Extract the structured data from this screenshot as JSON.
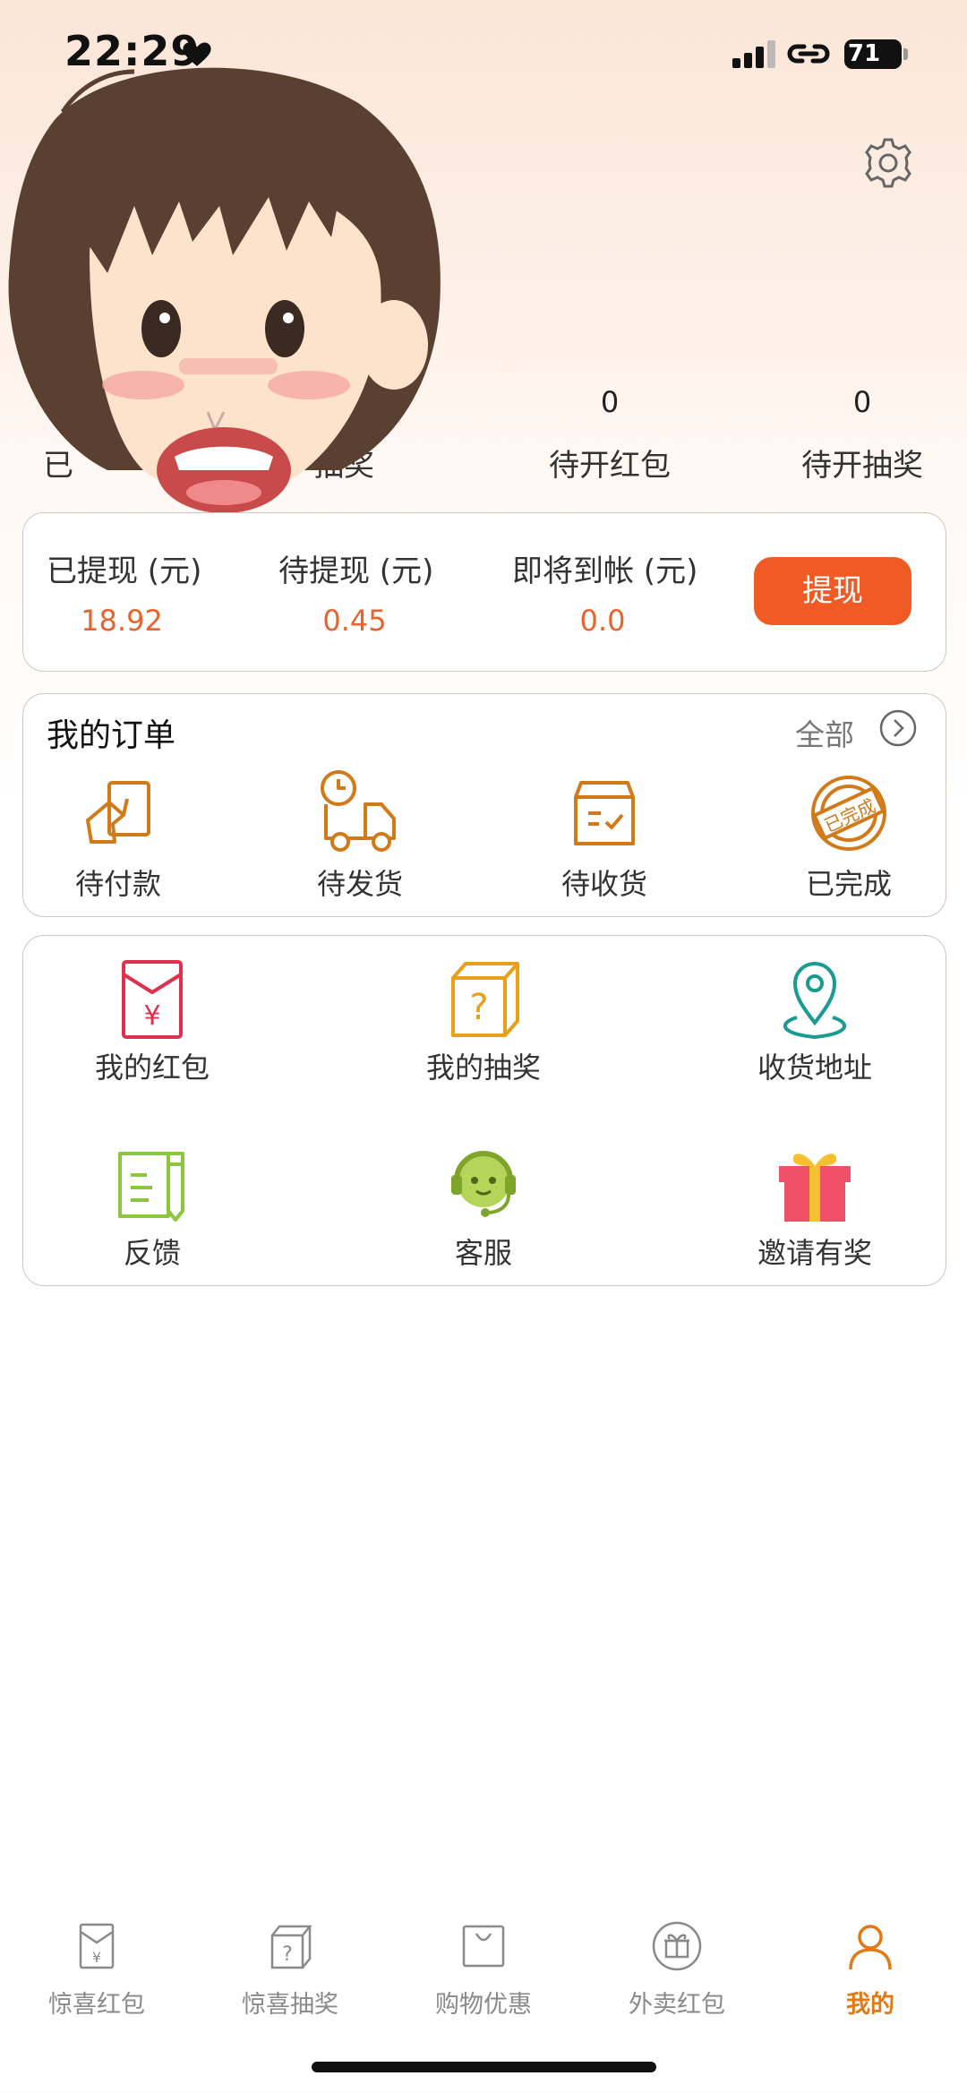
{
  "status_bar": {
    "time": "22:29",
    "battery": "71"
  },
  "stats": [
    {
      "value": "",
      "label": "已"
    },
    {
      "value": "",
      "label": "抽奖"
    },
    {
      "value": "0",
      "label": "待开红包"
    },
    {
      "value": "0",
      "label": "待开抽奖"
    }
  ],
  "withdraw": {
    "items": [
      {
        "label": "已提现 (元)",
        "value": "18.92"
      },
      {
        "label": "待提现 (元)",
        "value": "0.45"
      },
      {
        "label": "即将到帐 (元)",
        "value": "0.0"
      }
    ],
    "button": "提现"
  },
  "orders": {
    "title": "我的订单",
    "all_label": "全部",
    "items": [
      {
        "label": "待付款",
        "icon": "payment-icon"
      },
      {
        "label": "待发货",
        "icon": "delivery-truck-icon"
      },
      {
        "label": "待收货",
        "icon": "package-box-icon"
      },
      {
        "label": "已完成",
        "icon": "completed-stamp-icon",
        "stamp_text": "已完成"
      }
    ]
  },
  "services": {
    "items": [
      {
        "label": "我的红包",
        "icon": "red-envelope-icon",
        "symbol": "¥"
      },
      {
        "label": "我的抽奖",
        "icon": "mystery-box-icon",
        "symbol": "?"
      },
      {
        "label": "收货地址",
        "icon": "location-pin-icon"
      },
      {
        "label": "反馈",
        "icon": "feedback-icon"
      },
      {
        "label": "客服",
        "icon": "customer-service-icon"
      },
      {
        "label": "邀请有奖",
        "icon": "gift-icon"
      }
    ]
  },
  "tab_bar": {
    "tabs": [
      {
        "label": "惊喜红包",
        "icon": "red-envelope-outline-icon",
        "active": false
      },
      {
        "label": "惊喜抽奖",
        "icon": "mystery-box-outline-icon",
        "active": false
      },
      {
        "label": "购物优惠",
        "icon": "shopping-bag-icon",
        "active": false
      },
      {
        "label": "外卖红包",
        "icon": "gift-circle-icon",
        "active": false
      },
      {
        "label": "我的",
        "icon": "user-icon",
        "active": true
      }
    ]
  },
  "colors": {
    "accent": "#f05a24",
    "value_orange": "#e8632e",
    "tab_active": "#e07a16"
  }
}
